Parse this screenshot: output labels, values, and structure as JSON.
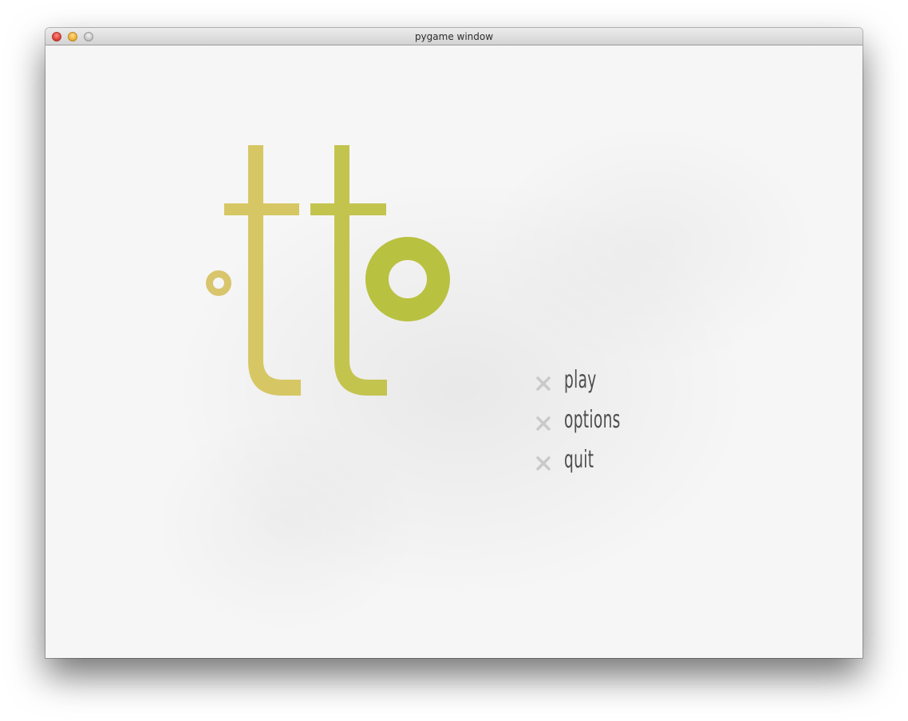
{
  "window": {
    "title": "pygame window"
  },
  "logo": {
    "text": "otto",
    "color_left": "#d9c56a",
    "color_right": "#b8c042"
  },
  "menu": {
    "items": [
      {
        "label": "play",
        "icon": "x-bullet-icon"
      },
      {
        "label": "options",
        "icon": "x-bullet-icon"
      },
      {
        "label": "quit",
        "icon": "x-bullet-icon"
      }
    ],
    "bullet_color": "#c9c9c9",
    "text_color": "#4d4d4d"
  },
  "colors": {
    "background": "#f6f6f6"
  }
}
